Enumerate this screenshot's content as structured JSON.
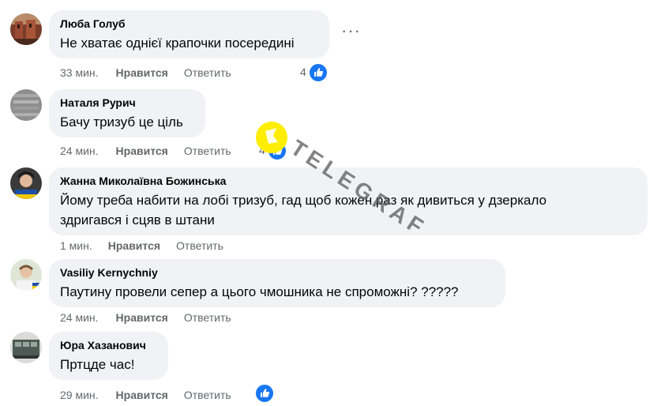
{
  "comments": [
    {
      "author": "Люба Голуб",
      "text_lines": [
        "Не хватає однієї крапочки посередині"
      ],
      "time": "33 мин.",
      "like_label": "Нравится",
      "reply_label": "Ответить",
      "reactions": "4"
    },
    {
      "author": "Наталя Рурич",
      "text_lines": [
        "Бачу тризуб це ціль"
      ],
      "time": "24 мин.",
      "like_label": "Нравится",
      "reply_label": "Ответить",
      "reactions": "4"
    },
    {
      "author": "Жанна Миколаївна Божинська",
      "text_lines": [
        "Йому треба набити на лобі тризуб, гад щоб кожен раз як дивиться у дзеркало",
        "здригався і сцяв в штани"
      ],
      "time": "1 мин.",
      "like_label": "Нравится",
      "reply_label": "Ответить",
      "reactions": ""
    },
    {
      "author": "Vasiliy Kernychniy",
      "text_lines": [
        "Паутину провели сепер а цього чмошника не спроможні? ?????"
      ],
      "time": "24 мин.",
      "like_label": "Нравится",
      "reply_label": "Ответить",
      "reactions": ""
    },
    {
      "author": "Юра Хазанович",
      "text_lines": [
        "Пртцде час!"
      ],
      "time": "29 мин.",
      "like_label": "Нравится",
      "reply_label": "Ответить",
      "reactions": ""
    }
  ],
  "more_button": "···",
  "watermark": {
    "text": "TELEGRAF",
    "color": "#5a5a5a",
    "logo_color": "#ffee00"
  },
  "colors": {
    "bubble": "#f0f2f5",
    "meta": "#65676b",
    "like_blue": "#1877f2"
  }
}
